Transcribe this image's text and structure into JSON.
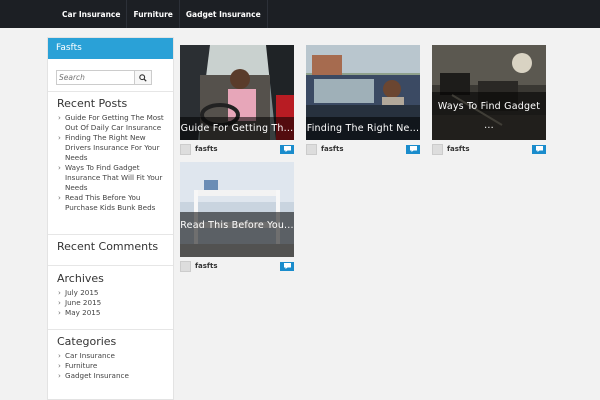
{
  "nav": {
    "items": [
      "Car Insurance",
      "Furniture",
      "Gadget Insurance"
    ]
  },
  "sidebar": {
    "site_title": "Fasfts",
    "search": {
      "placeholder": "Search"
    },
    "recent_posts": {
      "title": "Recent Posts",
      "items": [
        "Guide For Getting The Most Out Of Daily Car Insurance",
        "Finding The Right New Drivers Insurance For Your Needs",
        "Ways To Find Gadget Insurance That Will Fit Your Needs",
        "Read This Before You Purchase Kids Bunk Beds"
      ]
    },
    "recent_comments": {
      "title": "Recent Comments"
    },
    "archives": {
      "title": "Archives",
      "items": [
        "July 2015",
        "June 2015",
        "May 2015"
      ]
    },
    "categories": {
      "title": "Categories",
      "items": [
        "Car Insurance",
        "Furniture",
        "Gadget Insurance"
      ]
    }
  },
  "posts": [
    {
      "title": "Guide For Getting Th...",
      "author": "fasfts"
    },
    {
      "title": "Finding The Right Ne...",
      "author": "fasfts"
    },
    {
      "title": "Ways To Find Gadget ...",
      "author": "fasfts"
    },
    {
      "title": "Read This Before You...",
      "author": "fasfts"
    }
  ],
  "colors": {
    "nav_bg": "#1c1f24",
    "accent": "#2aa1d7",
    "comment_btn": "#1a8ccc"
  },
  "icons": {
    "search": "search-icon",
    "comment": "comment-icon",
    "avatar": "avatar-icon"
  }
}
